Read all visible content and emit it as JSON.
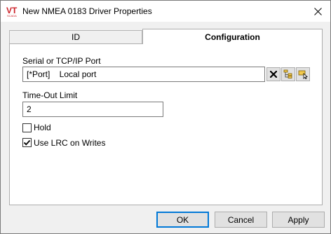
{
  "window": {
    "title": "New NMEA 0183 Driver Properties",
    "logo_text": "VT",
    "logo_subtext": "SCADA"
  },
  "tabs": [
    {
      "label": "ID",
      "selected": false
    },
    {
      "label": "Configuration",
      "selected": true
    }
  ],
  "config": {
    "port_label": "Serial or TCP/IP Port",
    "port_value": "[*Port]    Local port",
    "timeout_label": "Time-Out Limit",
    "timeout_value": "2",
    "hold_label": "Hold",
    "hold_checked": false,
    "lrc_label": "Use LRC on Writes",
    "lrc_checked": true
  },
  "buttons": {
    "ok": "OK",
    "cancel": "Cancel",
    "apply": "Apply"
  },
  "icons": {
    "clear": "x-icon",
    "tag_browser": "folder-tree-icon",
    "select_tag": "tag-pointer-icon"
  },
  "colors": {
    "accent": "#0078d7",
    "logo_red": "#cc2229"
  }
}
